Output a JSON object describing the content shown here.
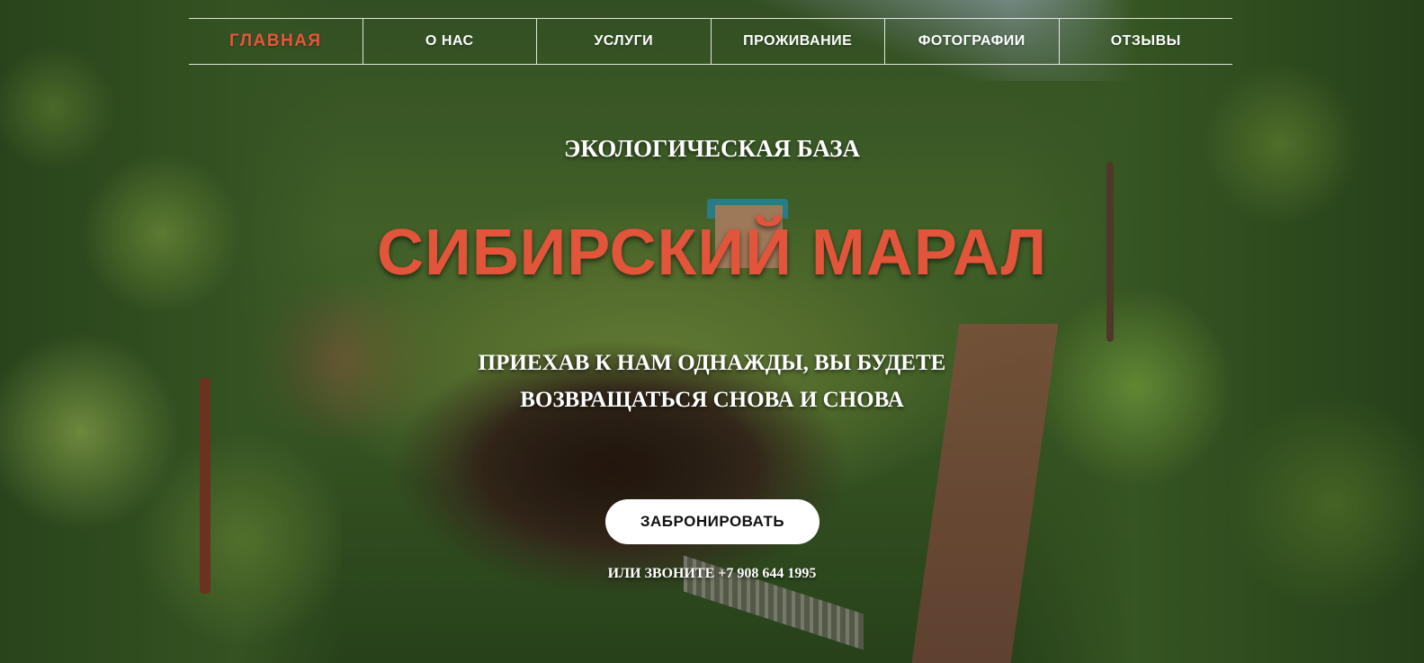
{
  "nav": {
    "items": [
      {
        "label": "ГЛАВНАЯ",
        "active": true
      },
      {
        "label": "О НАС",
        "active": false
      },
      {
        "label": "УСЛУГИ",
        "active": false
      },
      {
        "label": "ПРОЖИВАНИЕ",
        "active": false
      },
      {
        "label": "ФОТОГРАФИИ",
        "active": false
      },
      {
        "label": "ОТЗЫВЫ",
        "active": false
      }
    ]
  },
  "hero": {
    "subtitle": "ЭКОЛОГИЧЕСКАЯ БАЗА",
    "title": "СИБИРСКИЙ МАРАЛ",
    "tagline_line1": "ПРИЕХАВ К НАМ ОДНАЖДЫ, ВЫ БУДЕТЕ",
    "tagline_line2": "ВОЗВРАЩАТЬСЯ СНОВА И СНОВА",
    "book_button_label": "ЗАБРОНИРОВАТЬ",
    "call_text": "ИЛИ ЗВОНИТЕ +7 908 644 1995"
  },
  "colors": {
    "accent": "#e2553a",
    "button_bg": "#ffffff",
    "text": "#ffffff"
  }
}
